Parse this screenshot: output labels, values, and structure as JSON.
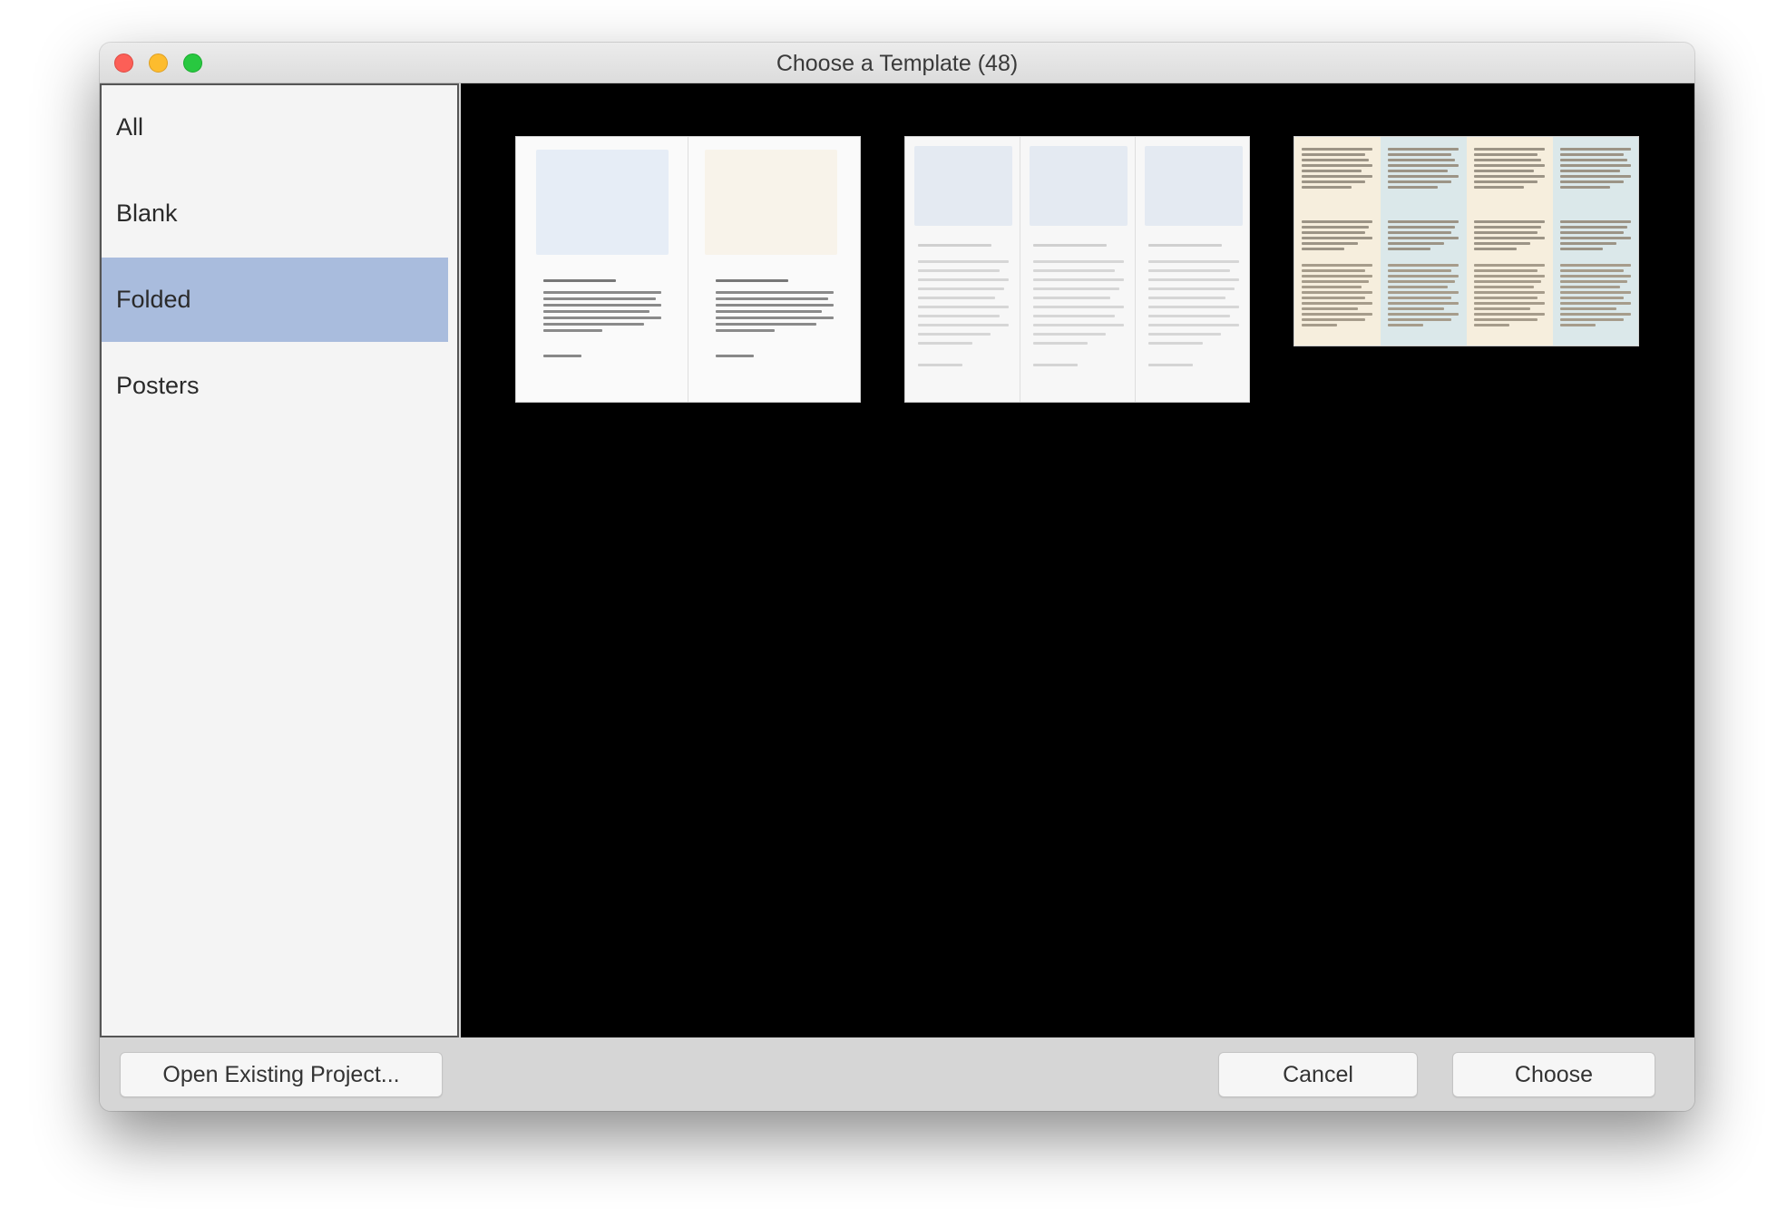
{
  "window": {
    "title": "Choose a Template (48)"
  },
  "sidebar": {
    "items": [
      {
        "label": "All",
        "selected": false
      },
      {
        "label": "Blank",
        "selected": false
      },
      {
        "label": "Folded",
        "selected": true
      },
      {
        "label": "Posters",
        "selected": false
      }
    ]
  },
  "templates": [
    {
      "name": "bi-fold-template",
      "panels": 2
    },
    {
      "name": "tri-fold-template",
      "panels": 3
    },
    {
      "name": "four-panel-text-template",
      "panels": 4
    }
  ],
  "footer": {
    "open_label": "Open Existing Project...",
    "cancel_label": "Cancel",
    "choose_label": "Choose"
  },
  "colors": {
    "selection": "#a9bcdd",
    "content_background": "#000000",
    "close": "#fc5f57",
    "minimize": "#fdbc2e",
    "maximize": "#28c840"
  }
}
